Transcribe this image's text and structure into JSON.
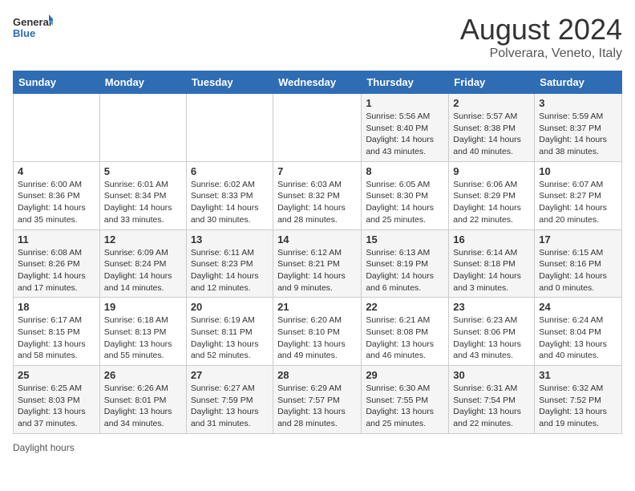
{
  "logo": {
    "general": "General",
    "blue": "Blue"
  },
  "title": "August 2024",
  "subtitle": "Polverara, Veneto, Italy",
  "days_of_week": [
    "Sunday",
    "Monday",
    "Tuesday",
    "Wednesday",
    "Thursday",
    "Friday",
    "Saturday"
  ],
  "footer": "Daylight hours",
  "weeks": [
    [
      {
        "day": "",
        "info": ""
      },
      {
        "day": "",
        "info": ""
      },
      {
        "day": "",
        "info": ""
      },
      {
        "day": "",
        "info": ""
      },
      {
        "day": "1",
        "info": "Sunrise: 5:56 AM\nSunset: 8:40 PM\nDaylight: 14 hours and 43 minutes."
      },
      {
        "day": "2",
        "info": "Sunrise: 5:57 AM\nSunset: 8:38 PM\nDaylight: 14 hours and 40 minutes."
      },
      {
        "day": "3",
        "info": "Sunrise: 5:59 AM\nSunset: 8:37 PM\nDaylight: 14 hours and 38 minutes."
      }
    ],
    [
      {
        "day": "4",
        "info": "Sunrise: 6:00 AM\nSunset: 8:36 PM\nDaylight: 14 hours and 35 minutes."
      },
      {
        "day": "5",
        "info": "Sunrise: 6:01 AM\nSunset: 8:34 PM\nDaylight: 14 hours and 33 minutes."
      },
      {
        "day": "6",
        "info": "Sunrise: 6:02 AM\nSunset: 8:33 PM\nDaylight: 14 hours and 30 minutes."
      },
      {
        "day": "7",
        "info": "Sunrise: 6:03 AM\nSunset: 8:32 PM\nDaylight: 14 hours and 28 minutes."
      },
      {
        "day": "8",
        "info": "Sunrise: 6:05 AM\nSunset: 8:30 PM\nDaylight: 14 hours and 25 minutes."
      },
      {
        "day": "9",
        "info": "Sunrise: 6:06 AM\nSunset: 8:29 PM\nDaylight: 14 hours and 22 minutes."
      },
      {
        "day": "10",
        "info": "Sunrise: 6:07 AM\nSunset: 8:27 PM\nDaylight: 14 hours and 20 minutes."
      }
    ],
    [
      {
        "day": "11",
        "info": "Sunrise: 6:08 AM\nSunset: 8:26 PM\nDaylight: 14 hours and 17 minutes."
      },
      {
        "day": "12",
        "info": "Sunrise: 6:09 AM\nSunset: 8:24 PM\nDaylight: 14 hours and 14 minutes."
      },
      {
        "day": "13",
        "info": "Sunrise: 6:11 AM\nSunset: 8:23 PM\nDaylight: 14 hours and 12 minutes."
      },
      {
        "day": "14",
        "info": "Sunrise: 6:12 AM\nSunset: 8:21 PM\nDaylight: 14 hours and 9 minutes."
      },
      {
        "day": "15",
        "info": "Sunrise: 6:13 AM\nSunset: 8:19 PM\nDaylight: 14 hours and 6 minutes."
      },
      {
        "day": "16",
        "info": "Sunrise: 6:14 AM\nSunset: 8:18 PM\nDaylight: 14 hours and 3 minutes."
      },
      {
        "day": "17",
        "info": "Sunrise: 6:15 AM\nSunset: 8:16 PM\nDaylight: 14 hours and 0 minutes."
      }
    ],
    [
      {
        "day": "18",
        "info": "Sunrise: 6:17 AM\nSunset: 8:15 PM\nDaylight: 13 hours and 58 minutes."
      },
      {
        "day": "19",
        "info": "Sunrise: 6:18 AM\nSunset: 8:13 PM\nDaylight: 13 hours and 55 minutes."
      },
      {
        "day": "20",
        "info": "Sunrise: 6:19 AM\nSunset: 8:11 PM\nDaylight: 13 hours and 52 minutes."
      },
      {
        "day": "21",
        "info": "Sunrise: 6:20 AM\nSunset: 8:10 PM\nDaylight: 13 hours and 49 minutes."
      },
      {
        "day": "22",
        "info": "Sunrise: 6:21 AM\nSunset: 8:08 PM\nDaylight: 13 hours and 46 minutes."
      },
      {
        "day": "23",
        "info": "Sunrise: 6:23 AM\nSunset: 8:06 PM\nDaylight: 13 hours and 43 minutes."
      },
      {
        "day": "24",
        "info": "Sunrise: 6:24 AM\nSunset: 8:04 PM\nDaylight: 13 hours and 40 minutes."
      }
    ],
    [
      {
        "day": "25",
        "info": "Sunrise: 6:25 AM\nSunset: 8:03 PM\nDaylight: 13 hours and 37 minutes."
      },
      {
        "day": "26",
        "info": "Sunrise: 6:26 AM\nSunset: 8:01 PM\nDaylight: 13 hours and 34 minutes."
      },
      {
        "day": "27",
        "info": "Sunrise: 6:27 AM\nSunset: 7:59 PM\nDaylight: 13 hours and 31 minutes."
      },
      {
        "day": "28",
        "info": "Sunrise: 6:29 AM\nSunset: 7:57 PM\nDaylight: 13 hours and 28 minutes."
      },
      {
        "day": "29",
        "info": "Sunrise: 6:30 AM\nSunset: 7:55 PM\nDaylight: 13 hours and 25 minutes."
      },
      {
        "day": "30",
        "info": "Sunrise: 6:31 AM\nSunset: 7:54 PM\nDaylight: 13 hours and 22 minutes."
      },
      {
        "day": "31",
        "info": "Sunrise: 6:32 AM\nSunset: 7:52 PM\nDaylight: 13 hours and 19 minutes."
      }
    ]
  ]
}
